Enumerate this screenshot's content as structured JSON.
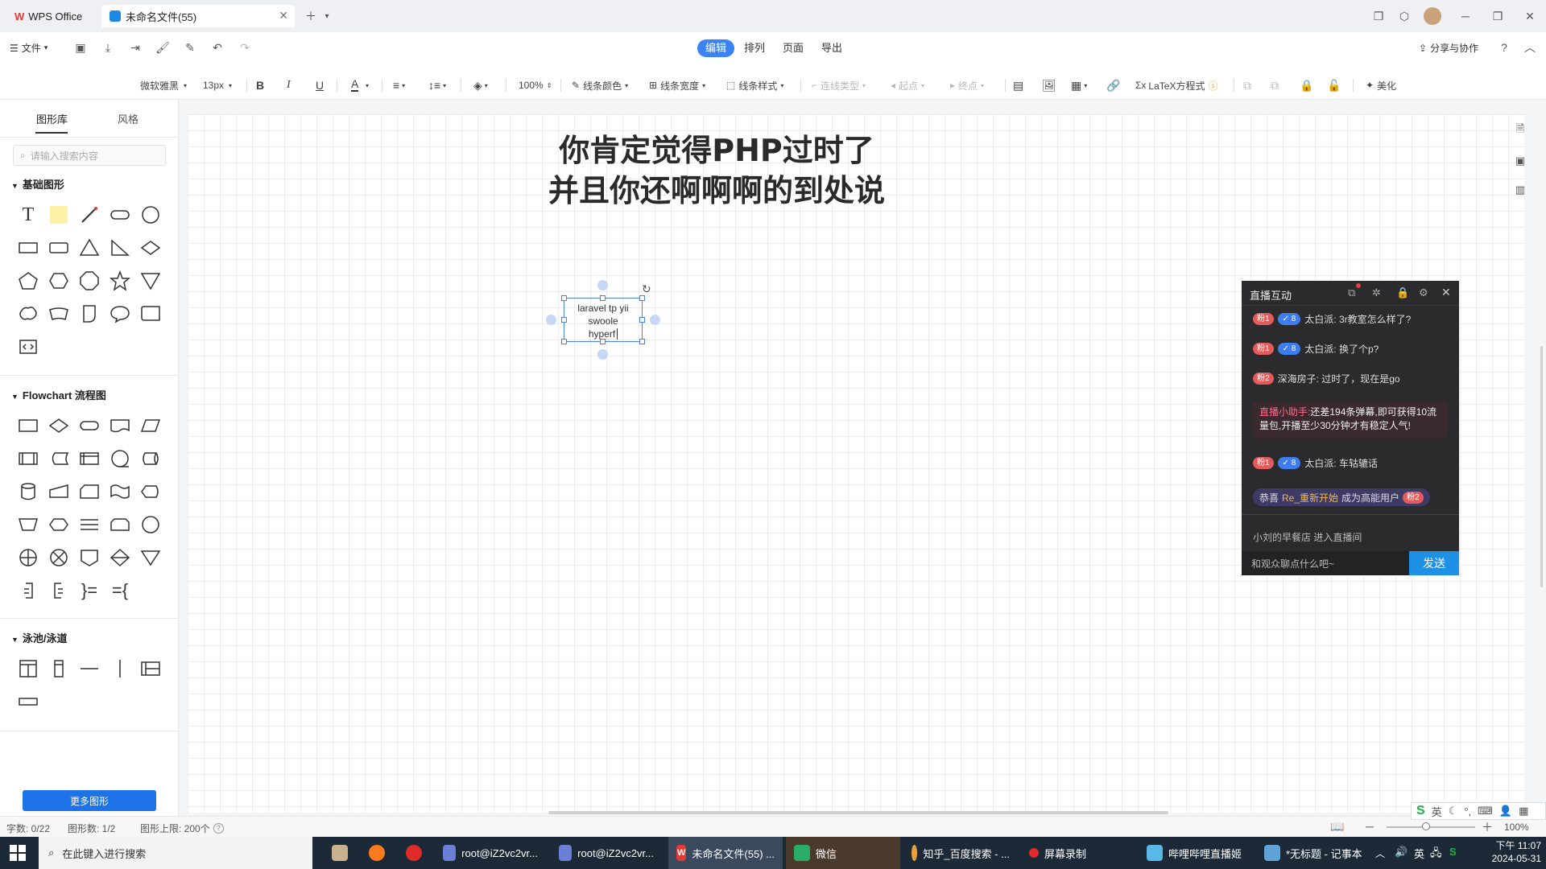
{
  "titlebar": {
    "tabs": [
      {
        "label": "WPS Office",
        "icon": "wps-logo-icon"
      },
      {
        "label": "未命名文件(55)",
        "icon": "flowchart-doc-icon"
      }
    ]
  },
  "menurow": {
    "file_menu": "文件",
    "mode_tabs": [
      "编辑",
      "排列",
      "页面",
      "导出"
    ],
    "share": "分享与协作"
  },
  "toolbar": {
    "font_family": "微软雅黑",
    "font_size": "13px",
    "zoom": "100%",
    "line_color": "线条颜色",
    "line_width": "线条宽度",
    "line_style": "线条样式",
    "connector_type": "连线类型",
    "start_point": "起点",
    "end_point": "终点",
    "latex": "LaTeX方程式",
    "beautify": "美化"
  },
  "sidebar": {
    "tabs": [
      "图形库",
      "风格"
    ],
    "search_placeholder": "请输入搜索内容",
    "sections": [
      "基础图形",
      "Flowchart 流程图",
      "泳池/泳道"
    ],
    "more_button": "更多图形"
  },
  "canvas": {
    "title_line1": "你肯定觉得PHP过时了",
    "title_line2": "并且你还啊啊啊的到处说",
    "textbox_lines": [
      "laravel tp yii",
      "swoole",
      "hyperf"
    ]
  },
  "chat": {
    "title": "直播互动",
    "messages": [
      {
        "level": "粉1",
        "vip": "8",
        "text": "太白派: 3r教室怎么样了?"
      },
      {
        "level": "粉1",
        "vip": "8",
        "text": "太白派: 换了个p?"
      },
      {
        "level": "粉2",
        "text": "深海房子: 过时了，现在是go"
      },
      {
        "level": "粉1",
        "vip": "8",
        "text": "太白派: 车轱辘话"
      }
    ],
    "assistant_name": "直播小助手:",
    "assistant_text": "还差194条弹幕,即可获得10流量包,开播至少30分钟才有稳定人气!",
    "congrats_prefix": "恭喜",
    "congrats_user": "Re_重新开始",
    "congrats_suffix": "成为高能用户",
    "congrats_badge": "粉2",
    "enter_notice": "小刘的早餐店 进入直播间",
    "input_placeholder": "和观众聊点什么吧~",
    "send_button": "发送"
  },
  "statusbar": {
    "word_count": "字数: 0/22",
    "shape_count": "图形数: 1/2",
    "shape_limit": "图形上限: 200个",
    "zoom": "100%"
  },
  "taskbar": {
    "search_placeholder": "在此键入进行搜索",
    "tasks": [
      "root@iZ2vc2vr...",
      "root@iZ2vc2vr...",
      "未命名文件(55) ...",
      "微信",
      "知乎_百度搜索 - ...",
      "屏幕录制",
      "哔哩哔哩直播姬",
      "*无标题 - 记事本"
    ],
    "ime": "英",
    "time": "下午 11:07",
    "date": "2024-05-31"
  },
  "colors": {
    "accent": "#3b82f6",
    "taskbar": "#1c2a38",
    "chat_bg": "#2b2b2d",
    "send_button": "#1e90e6"
  }
}
